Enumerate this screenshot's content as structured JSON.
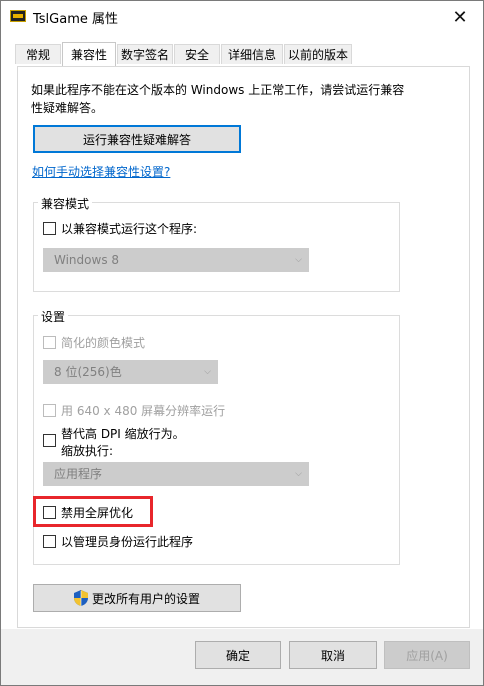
{
  "window": {
    "title": "TslGame 属性",
    "close_glyph": "✕"
  },
  "tabs": [
    {
      "label": "常规"
    },
    {
      "label": "兼容性"
    },
    {
      "label": "数字签名"
    },
    {
      "label": "安全"
    },
    {
      "label": "详细信息"
    },
    {
      "label": "以前的版本"
    }
  ],
  "description": "如果此程序不能在这个版本的 Windows 上正常工作，请尝试运行兼容性疑难解答。",
  "troubleshoot_button": "运行兼容性疑难解答",
  "manual_link": "如何手动选择兼容性设置?",
  "compat_mode": {
    "group_title": "兼容模式",
    "checkbox_label": "以兼容模式运行这个程序:",
    "select_value": "Windows 8"
  },
  "settings": {
    "group_title": "设置",
    "reduced_color": "简化的颜色模式",
    "color_select": "8 位(256)色",
    "low_res": "用 640 x 480 屏幕分辨率运行",
    "dpi_line1": "替代高 DPI 缩放行为。",
    "dpi_line2": "缩放执行:",
    "dpi_select": "应用程序",
    "fullscreen_opt": "禁用全屏优化",
    "run_admin": "以管理员身份运行此程序"
  },
  "change_all_button": "更改所有用户的设置",
  "buttons": {
    "ok": "确定",
    "cancel": "取消",
    "apply": "应用(A)"
  },
  "colors": {
    "accent": "#0078d7",
    "highlight": "#e8262b",
    "link": "#0066cc"
  }
}
